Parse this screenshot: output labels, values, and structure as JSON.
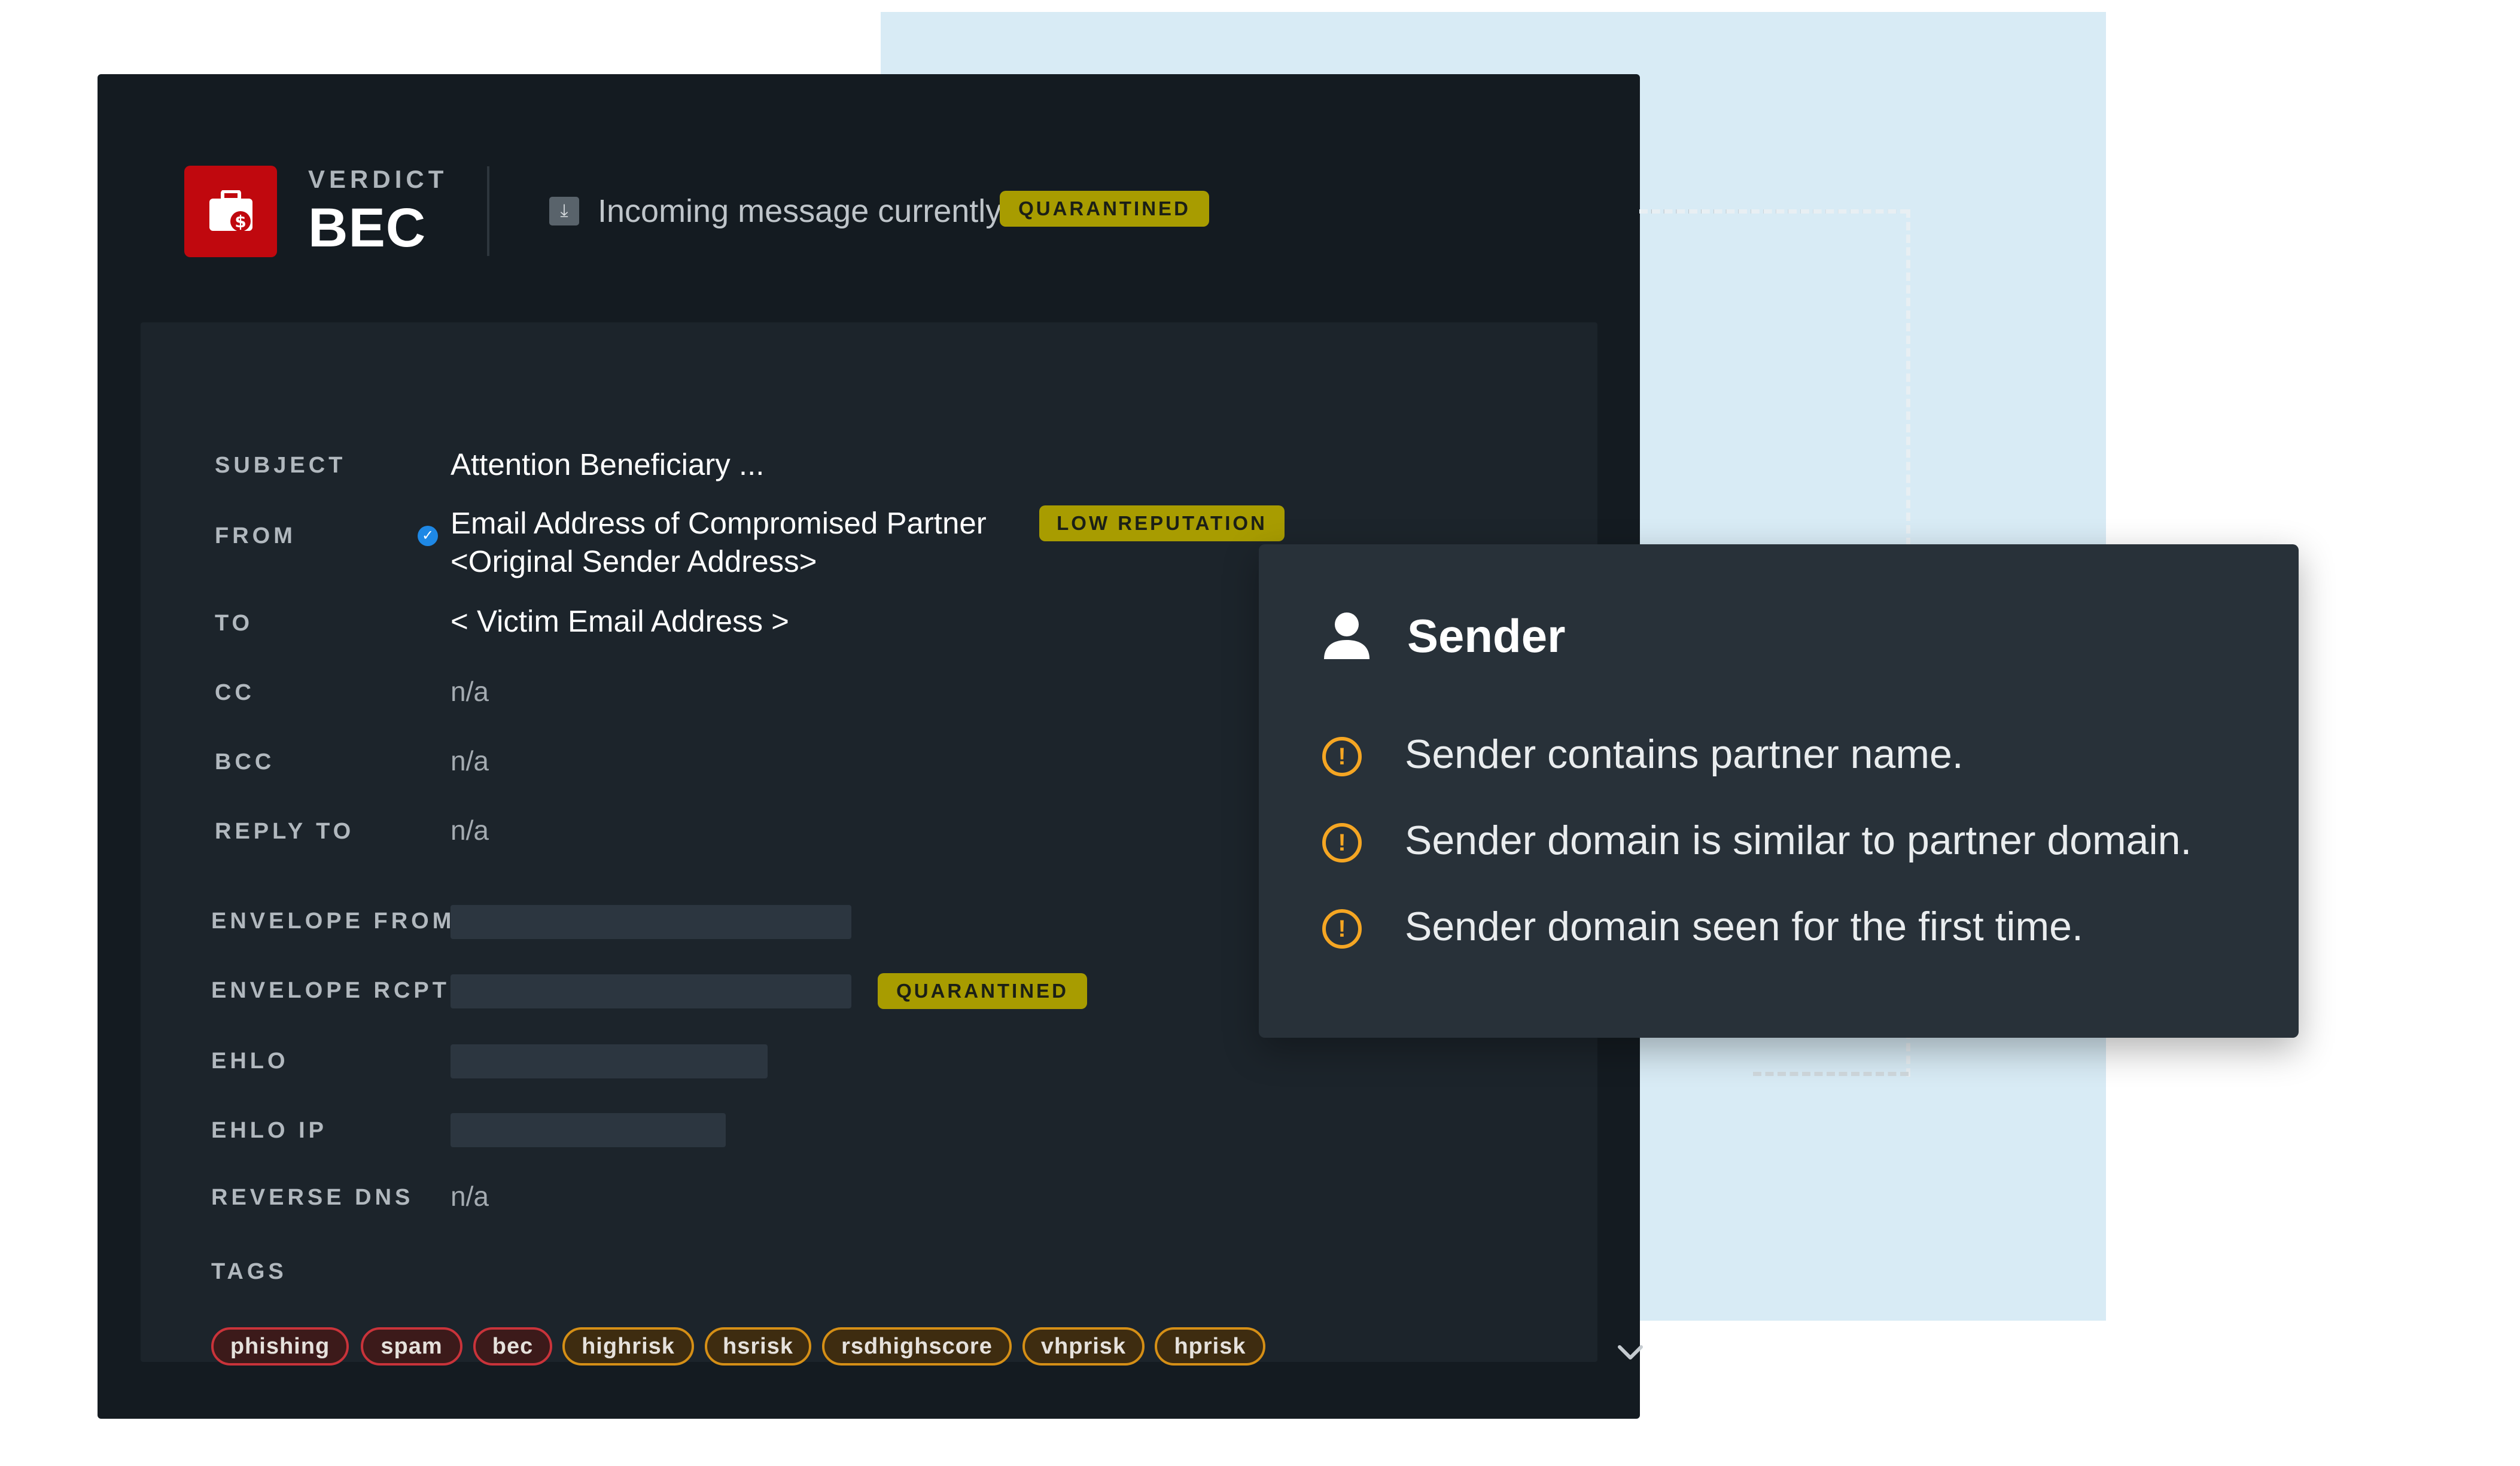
{
  "verdict": {
    "label": "VERDICT",
    "value": "BEC",
    "icon": "briefcase-dollar-icon",
    "color": "#c0080e"
  },
  "status": {
    "icon": "download-tray-icon",
    "text": "Incoming message currently",
    "badge": "QUARANTINED"
  },
  "fields": {
    "subject": {
      "label": "SUBJECT",
      "value": "Attention Beneficiary ..."
    },
    "from": {
      "label": "FROM",
      "value_line1": "Email Address of Compromised Partner",
      "value_line2": "<Original Sender Address>",
      "badge": "LOW REPUTATION",
      "icon": "verified-check-icon"
    },
    "to": {
      "label": "TO",
      "value": "< Victim Email Address >"
    },
    "cc": {
      "label": "CC",
      "value": "n/a"
    },
    "bcc": {
      "label": "BCC",
      "value": "n/a"
    },
    "reply_to": {
      "label": "REPLY TO",
      "value": "n/a"
    },
    "envelope_from": {
      "label": "ENVELOPE FROM"
    },
    "envelope_rcpt": {
      "label": "ENVELOPE RCPT",
      "badge": "QUARANTINED"
    },
    "ehlo": {
      "label": "EHLO"
    },
    "ehlo_ip": {
      "label": "EHLO IP"
    },
    "reverse_dns": {
      "label": "REVERSE DNS",
      "value": "n/a"
    }
  },
  "tags": {
    "label": "TAGS",
    "items": [
      {
        "name": "phishing",
        "color": "red"
      },
      {
        "name": "spam",
        "color": "red"
      },
      {
        "name": "bec",
        "color": "red"
      },
      {
        "name": "highrisk",
        "color": "orange"
      },
      {
        "name": "hsrisk",
        "color": "orange"
      },
      {
        "name": "rsdhighscore",
        "color": "orange"
      },
      {
        "name": "vhprisk",
        "color": "orange"
      },
      {
        "name": "hprisk",
        "color": "orange"
      }
    ],
    "expand_icon": "chevron-down-icon"
  },
  "popup": {
    "icon": "user-icon",
    "title": "Sender",
    "items": [
      {
        "icon": "alert-circle-icon",
        "text": "Sender contains partner name."
      },
      {
        "icon": "alert-circle-icon",
        "text": "Sender domain is similar to partner domain."
      },
      {
        "icon": "alert-circle-icon",
        "text": "Sender domain seen for the first time."
      }
    ]
  },
  "colors": {
    "panel": "#141b21",
    "card": "#1c242b",
    "badge_yellow": "#a89c00",
    "alert": "#f5a623",
    "backdrop": "#d8ebf5"
  }
}
